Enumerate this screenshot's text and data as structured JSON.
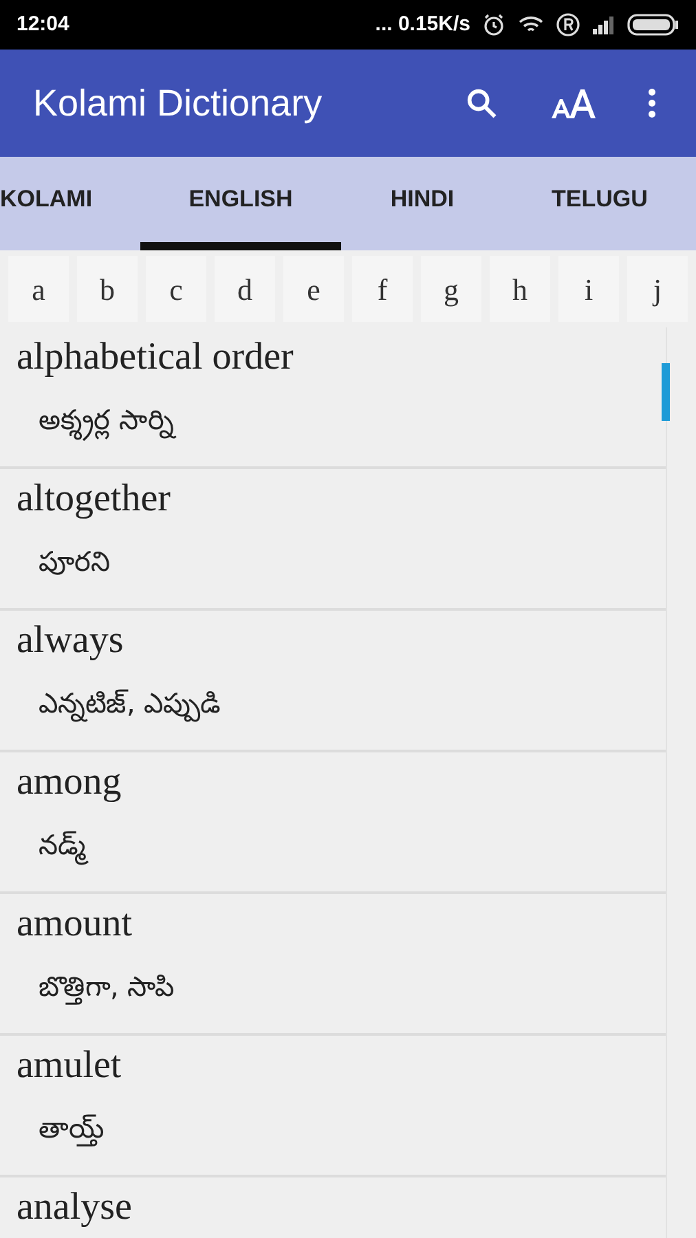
{
  "status_bar": {
    "time": "12:04",
    "network_speed": "... 0.15K/s"
  },
  "app_bar": {
    "title": "Kolami Dictionary"
  },
  "tabs": [
    {
      "label": "KOLAMI",
      "selected": false
    },
    {
      "label": "ENGLISH",
      "selected": true
    },
    {
      "label": "HINDI",
      "selected": false
    },
    {
      "label": "TELUGU",
      "selected": false
    }
  ],
  "letters": [
    "a",
    "b",
    "c",
    "d",
    "e",
    "f",
    "g",
    "h",
    "i",
    "j"
  ],
  "entries": [
    {
      "word": "alphabetical order",
      "translation": "అక్శ్రర్ల సార్ని"
    },
    {
      "word": "altogether",
      "translation": "పూరని"
    },
    {
      "word": "always",
      "translation": "ఎన్నటిజ్, ఎప్పుడి"
    },
    {
      "word": "among",
      "translation": "నడ్మ్"
    },
    {
      "word": "amount",
      "translation": "బొత్తిగా, సాపి"
    },
    {
      "word": "amulet",
      "translation": "తాయ్త్"
    },
    {
      "word": "analyse"
    }
  ]
}
